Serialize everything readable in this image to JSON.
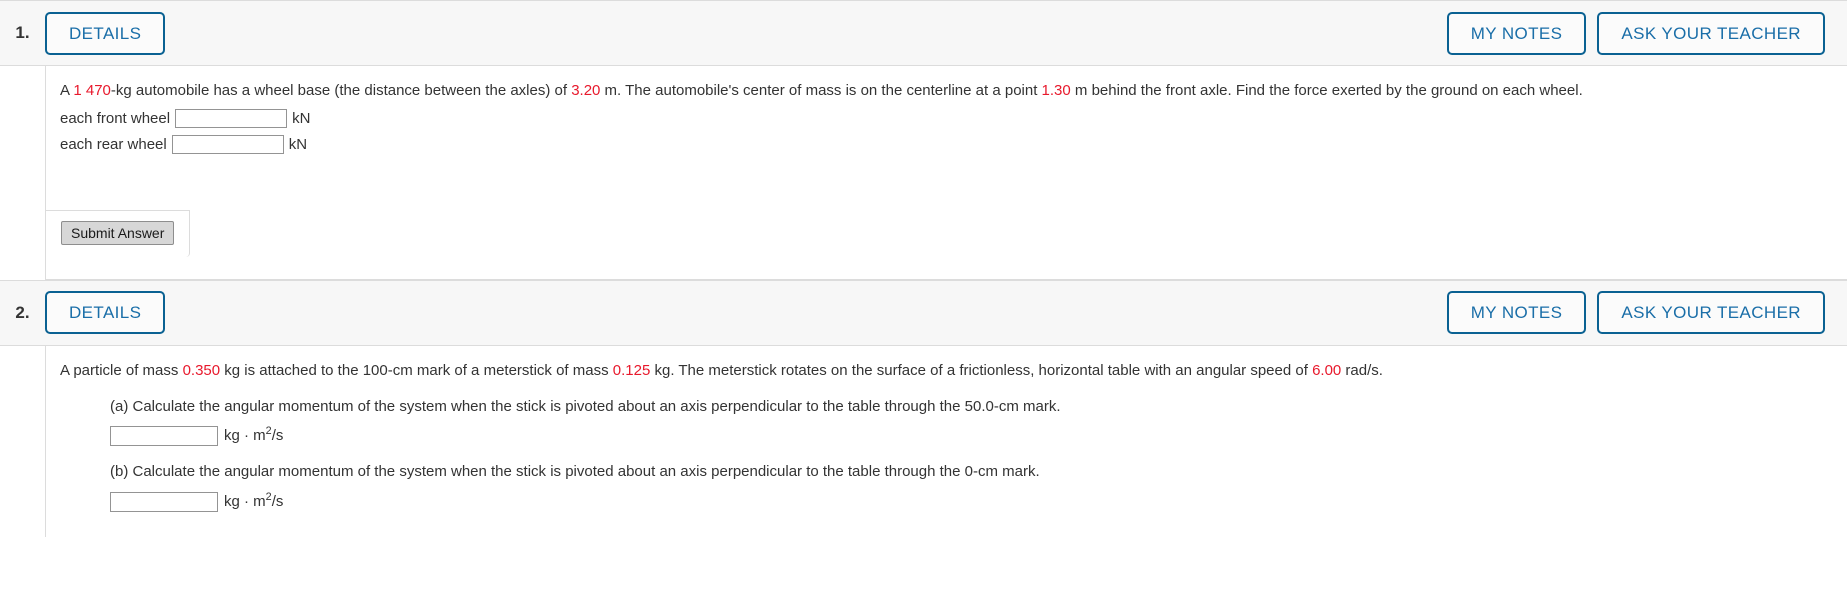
{
  "buttons": {
    "details": "DETAILS",
    "my_notes": "MY NOTES",
    "ask_your_teacher": "ASK YOUR TEACHER",
    "submit_answer": "Submit Answer"
  },
  "colors": {
    "accent_blue": "#0a6192",
    "link_blue": "#1a6ea8",
    "value_red": "#e8192c",
    "header_bg": "#f7f7f7",
    "border_gray": "#dcdcdc"
  },
  "questions": [
    {
      "number": "1.",
      "prompt": {
        "seg1": "A ",
        "val1": "1 470",
        "seg2": "-kg automobile has a wheel base (the distance between the axles) of ",
        "val2": "3.20",
        "seg3": " m. The automobile's center of mass is on the centerline at a point ",
        "val3": "1.30",
        "seg4": " m behind the front axle. Find the force exerted by the ground on each wheel."
      },
      "answers": [
        {
          "label": "each front wheel",
          "value": "",
          "unit": "kN"
        },
        {
          "label": "each rear wheel",
          "value": "",
          "unit": "kN"
        }
      ]
    },
    {
      "number": "2.",
      "prompt": {
        "seg1": "A particle of mass ",
        "val1": "0.350",
        "seg2": " kg is attached to the 100-cm mark of a meterstick of mass ",
        "val2": "0.125",
        "seg3": " kg. The meterstick rotates on the surface of a frictionless, horizontal table with an angular speed of ",
        "val3": "6.00",
        "seg4": " rad/s."
      },
      "parts": [
        {
          "text": "(a) Calculate the angular momentum of the system when the stick is pivoted about an axis perpendicular to the table through the 50.0-cm mark.",
          "value": "",
          "unit_base": "kg · m",
          "unit_exp": "2",
          "unit_tail": "/s"
        },
        {
          "text": "(b) Calculate the angular momentum of the system when the stick is pivoted about an axis perpendicular to the table through the 0-cm mark.",
          "value": "",
          "unit_base": "kg · m",
          "unit_exp": "2",
          "unit_tail": "/s"
        }
      ]
    }
  ]
}
